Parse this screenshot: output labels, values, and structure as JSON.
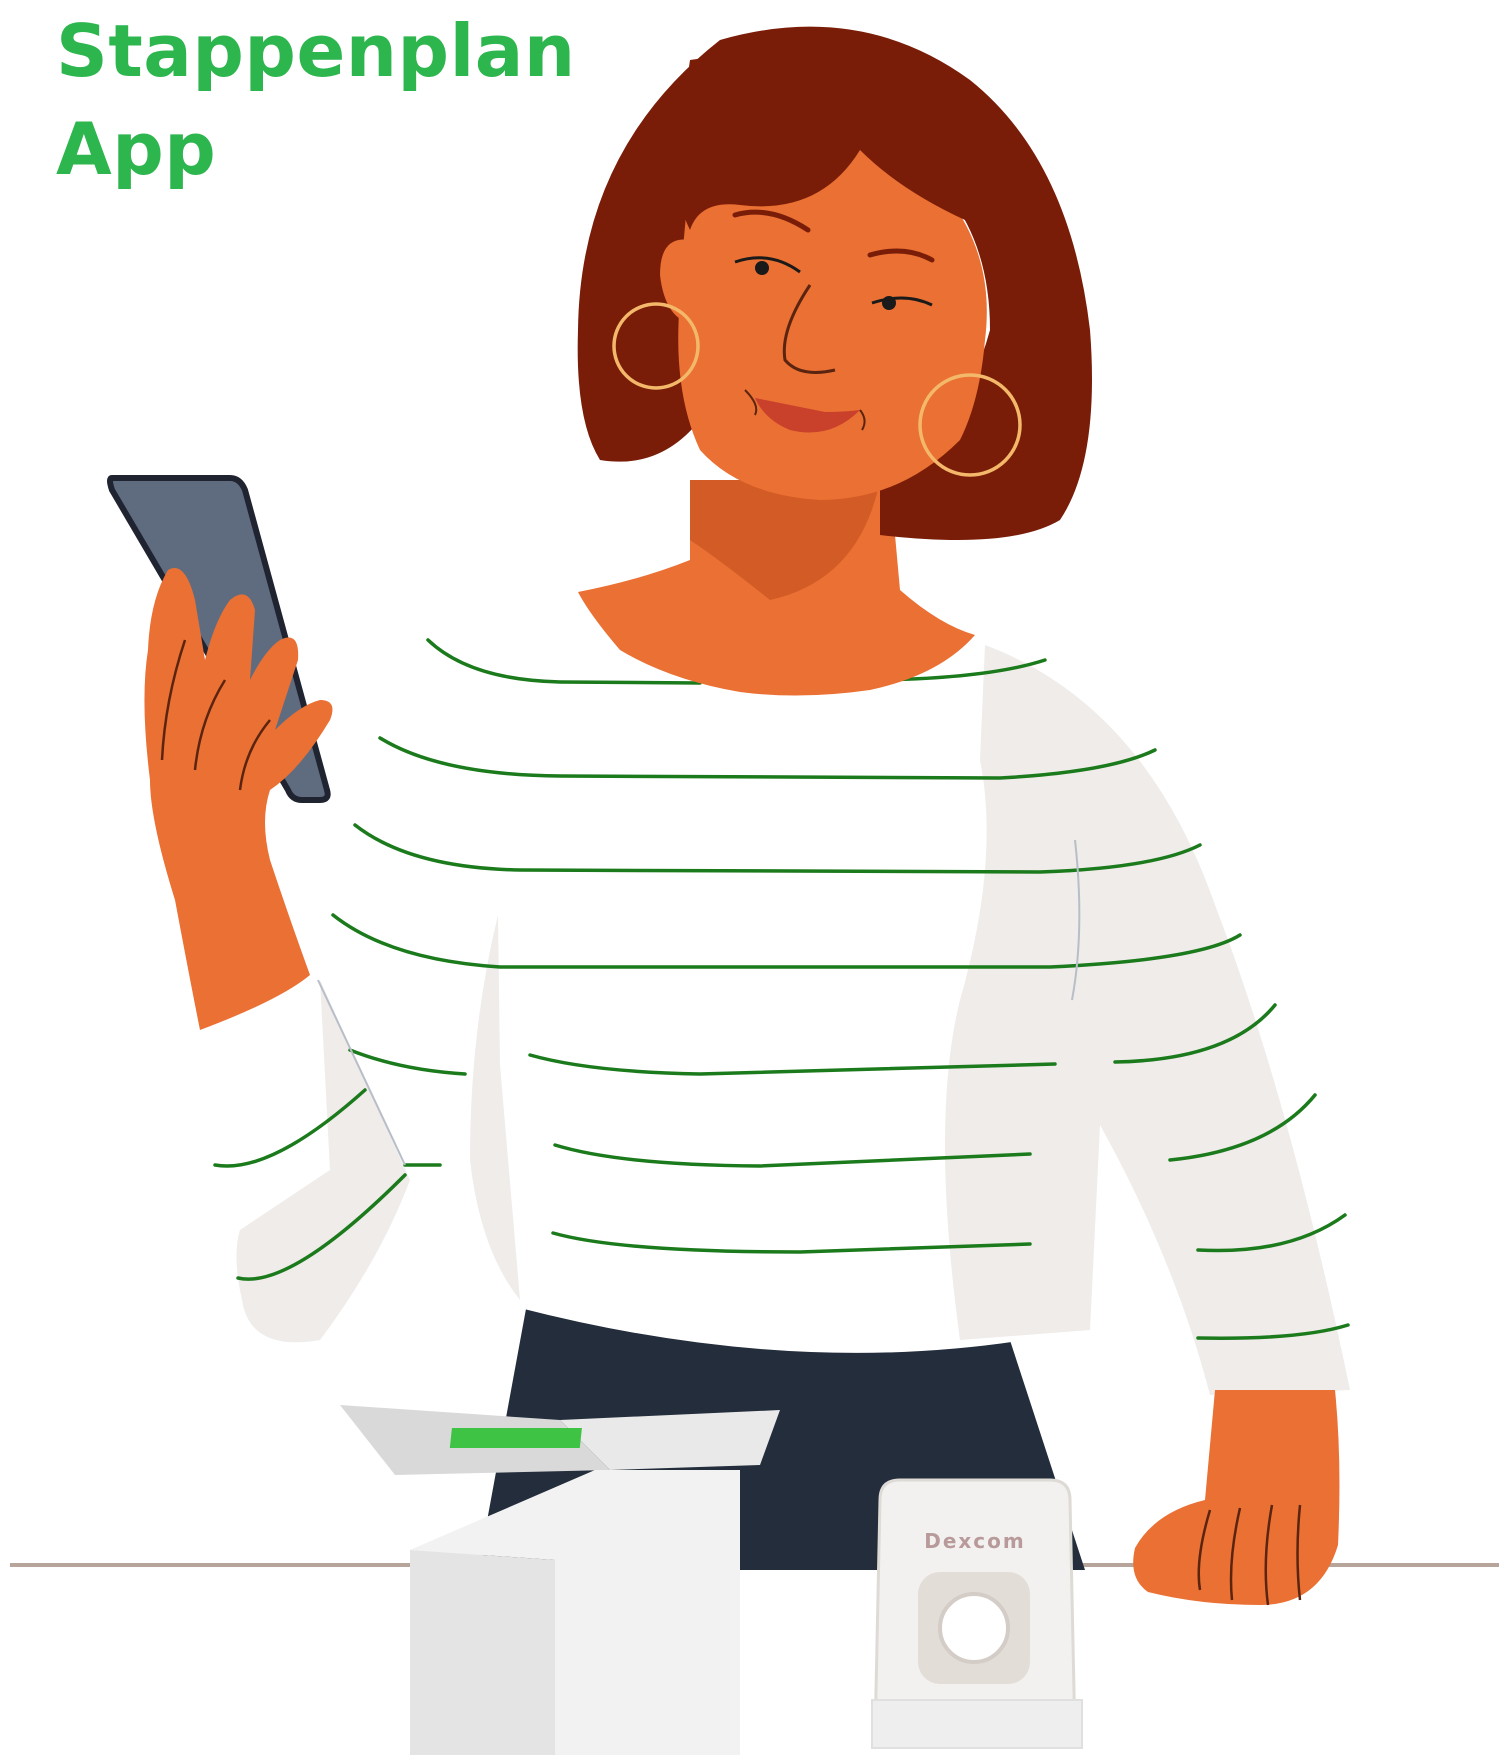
{
  "heading": {
    "line1": "Stappenplan",
    "line2": "App"
  },
  "device": {
    "brand_label": "Dexcom"
  },
  "colors": {
    "heading_green": "#2db54e",
    "stripe_green": "#1b7a1b",
    "skin": "#ea7033",
    "hair": "#7a1d08",
    "phone": "#5f6c80",
    "skirt": "#232d3b",
    "table_line": "#b7a49b"
  }
}
